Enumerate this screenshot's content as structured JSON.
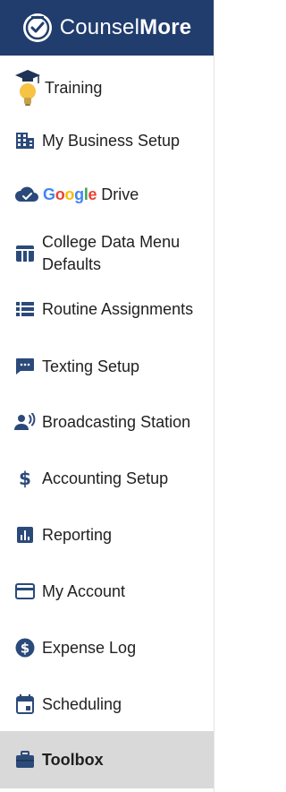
{
  "brand": {
    "name_light": "Counsel",
    "name_bold": "More"
  },
  "menu": {
    "training": {
      "label": "Training",
      "icon": "lightbulb-graduation-icon"
    },
    "business_setup": {
      "label": "My Business Setup",
      "icon": "building-icon"
    },
    "google_drive": {
      "label": "Drive",
      "google_letters": [
        "G",
        "o",
        "o",
        "g",
        "l",
        "e"
      ],
      "icon": "cloud-check-icon"
    },
    "college_data": {
      "label": "College Data Menu Defaults",
      "icon": "table-columns-icon"
    },
    "routine_assignments": {
      "label": "Routine Assignments",
      "icon": "list-icon"
    },
    "texting_setup": {
      "label": "Texting Setup",
      "icon": "chat-bubble-icon"
    },
    "broadcasting_station": {
      "label": "Broadcasting Station",
      "icon": "broadcast-person-icon"
    },
    "accounting_setup": {
      "label": "Accounting Setup",
      "icon": "dollar-icon"
    },
    "reporting": {
      "label": "Reporting",
      "icon": "bar-chart-icon"
    },
    "my_account": {
      "label": "My Account",
      "icon": "credit-card-icon"
    },
    "expense_log": {
      "label": "Expense Log",
      "icon": "dollar-circle-icon"
    },
    "scheduling": {
      "label": "Scheduling",
      "icon": "calendar-icon"
    },
    "toolbox": {
      "label": "Toolbox",
      "icon": "toolbox-icon",
      "active": true
    }
  },
  "colors": {
    "brand_bar": "#213d6e",
    "icon_navy": "#2b4a7a",
    "active_bg": "#d9d9d9",
    "text": "#1f1f1f"
  }
}
